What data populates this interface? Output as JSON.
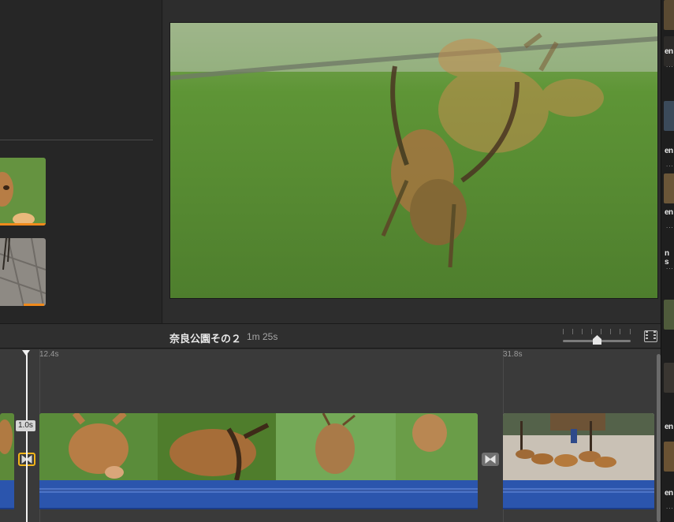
{
  "timeline": {
    "project_title": "奈良公園その２",
    "project_duration": "1m 25s",
    "ruler": [
      {
        "label": "12.4s"
      },
      {
        "label": "31.8s"
      }
    ],
    "transition_duration": "1.0s",
    "zoom_level": 0.5
  },
  "right_strip": {
    "labels": [
      "en",
      "en",
      "en",
      "n s",
      "en",
      "en"
    ],
    "dots": [
      "...",
      "...",
      "...",
      "...3",
      "...",
      "..."
    ]
  },
  "colors": {
    "selection_accent": "#f2b51a",
    "used_range": "#f08a1c",
    "audio_waveform": "#2b55ad",
    "grass": "#5c8c34",
    "deer": "#b77d45"
  },
  "icons": {
    "transition": "bowtie-transition-icon",
    "filmstrip": "filmstrip-icon",
    "playhead": "playhead-icon"
  }
}
